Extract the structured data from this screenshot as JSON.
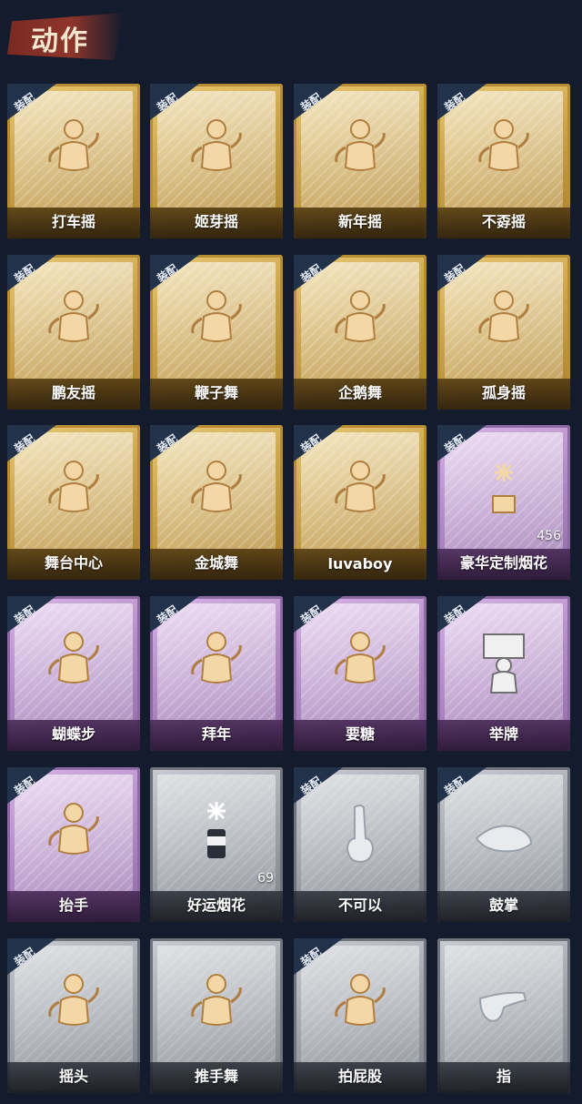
{
  "header": {
    "title": "动作"
  },
  "colors": {
    "gold": "#c9a24a",
    "purple": "#b48dc7",
    "gray": "#9fa3aa",
    "equip_tag": "#22324a",
    "background": "#131b2c"
  },
  "equip_label": "装配",
  "cards": [
    {
      "label": "打车摇",
      "rarity": "gold",
      "equipped": true,
      "icon": "dancer-icon"
    },
    {
      "label": "姬芽摇",
      "rarity": "gold",
      "equipped": true,
      "icon": "dancer-icon"
    },
    {
      "label": "新年摇",
      "rarity": "gold",
      "equipped": true,
      "icon": "dancer-icon"
    },
    {
      "label": "不孬摇",
      "rarity": "gold",
      "equipped": true,
      "icon": "dancer-icon"
    },
    {
      "label": "鹏友摇",
      "rarity": "gold",
      "equipped": true,
      "icon": "dancer-icon"
    },
    {
      "label": "鞭子舞",
      "rarity": "gold",
      "equipped": true,
      "icon": "dancer-icon"
    },
    {
      "label": "企鹅舞",
      "rarity": "gold",
      "equipped": true,
      "icon": "dancer-icon"
    },
    {
      "label": "孤身摇",
      "rarity": "gold",
      "equipped": true,
      "icon": "dancer-icon"
    },
    {
      "label": "舞台中心",
      "rarity": "gold",
      "equipped": true,
      "icon": "dancer-icon"
    },
    {
      "label": "金城舞",
      "rarity": "gold",
      "equipped": true,
      "icon": "dancer-icon"
    },
    {
      "label": "luvaboy",
      "rarity": "gold",
      "equipped": true,
      "icon": "dancer-icon"
    },
    {
      "label": "豪华定制烟花",
      "rarity": "purple",
      "equipped": true,
      "icon": "fireworks-icon",
      "count": "456"
    },
    {
      "label": "蝴蝶步",
      "rarity": "purple",
      "equipped": true,
      "icon": "dancer-icon"
    },
    {
      "label": "拜年",
      "rarity": "purple",
      "equipped": true,
      "icon": "dancer-icon"
    },
    {
      "label": "要糖",
      "rarity": "purple",
      "equipped": true,
      "icon": "dancer-icon"
    },
    {
      "label": "举牌",
      "rarity": "purple",
      "equipped": true,
      "icon": "sign-holder-icon"
    },
    {
      "label": "抬手",
      "rarity": "purple",
      "equipped": true,
      "icon": "dancer-icon"
    },
    {
      "label": "好运烟花",
      "rarity": "gray",
      "equipped": false,
      "icon": "firework-can-icon",
      "count": "69"
    },
    {
      "label": "不可以",
      "rarity": "gray",
      "equipped": true,
      "icon": "finger-icon"
    },
    {
      "label": "鼓掌",
      "rarity": "gray",
      "equipped": true,
      "icon": "clap-icon"
    },
    {
      "label": "摇头",
      "rarity": "gray",
      "equipped": true,
      "icon": "dancer-icon"
    },
    {
      "label": "推手舞",
      "rarity": "gray",
      "equipped": false,
      "icon": "dancer-icon"
    },
    {
      "label": "拍屁股",
      "rarity": "gray",
      "equipped": true,
      "icon": "dancer-icon"
    },
    {
      "label": "指",
      "rarity": "gray",
      "equipped": false,
      "icon": "pointing-hand-icon"
    }
  ]
}
